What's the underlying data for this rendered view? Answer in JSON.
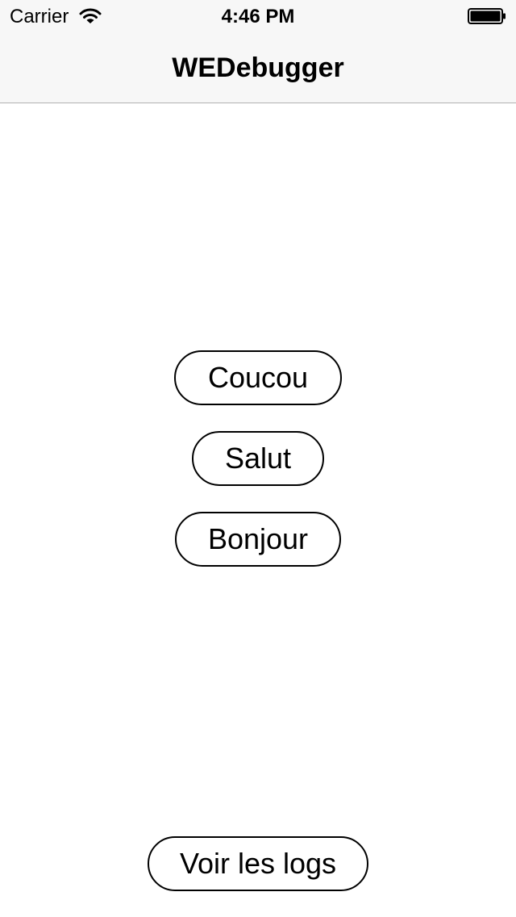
{
  "status_bar": {
    "carrier": "Carrier",
    "time": "4:46 PM",
    "wifi_icon": "wifi-icon",
    "battery_icon": "battery-full-icon"
  },
  "nav_bar": {
    "title": "WEDebugger"
  },
  "buttons": {
    "coucou": "Coucou",
    "salut": "Salut",
    "bonjour": "Bonjour",
    "logs": "Voir les logs"
  },
  "colors": {
    "nav_background": "#f7f7f7",
    "nav_border": "#b2b2b2",
    "text": "#000000",
    "button_border": "#000000",
    "background": "#ffffff"
  }
}
